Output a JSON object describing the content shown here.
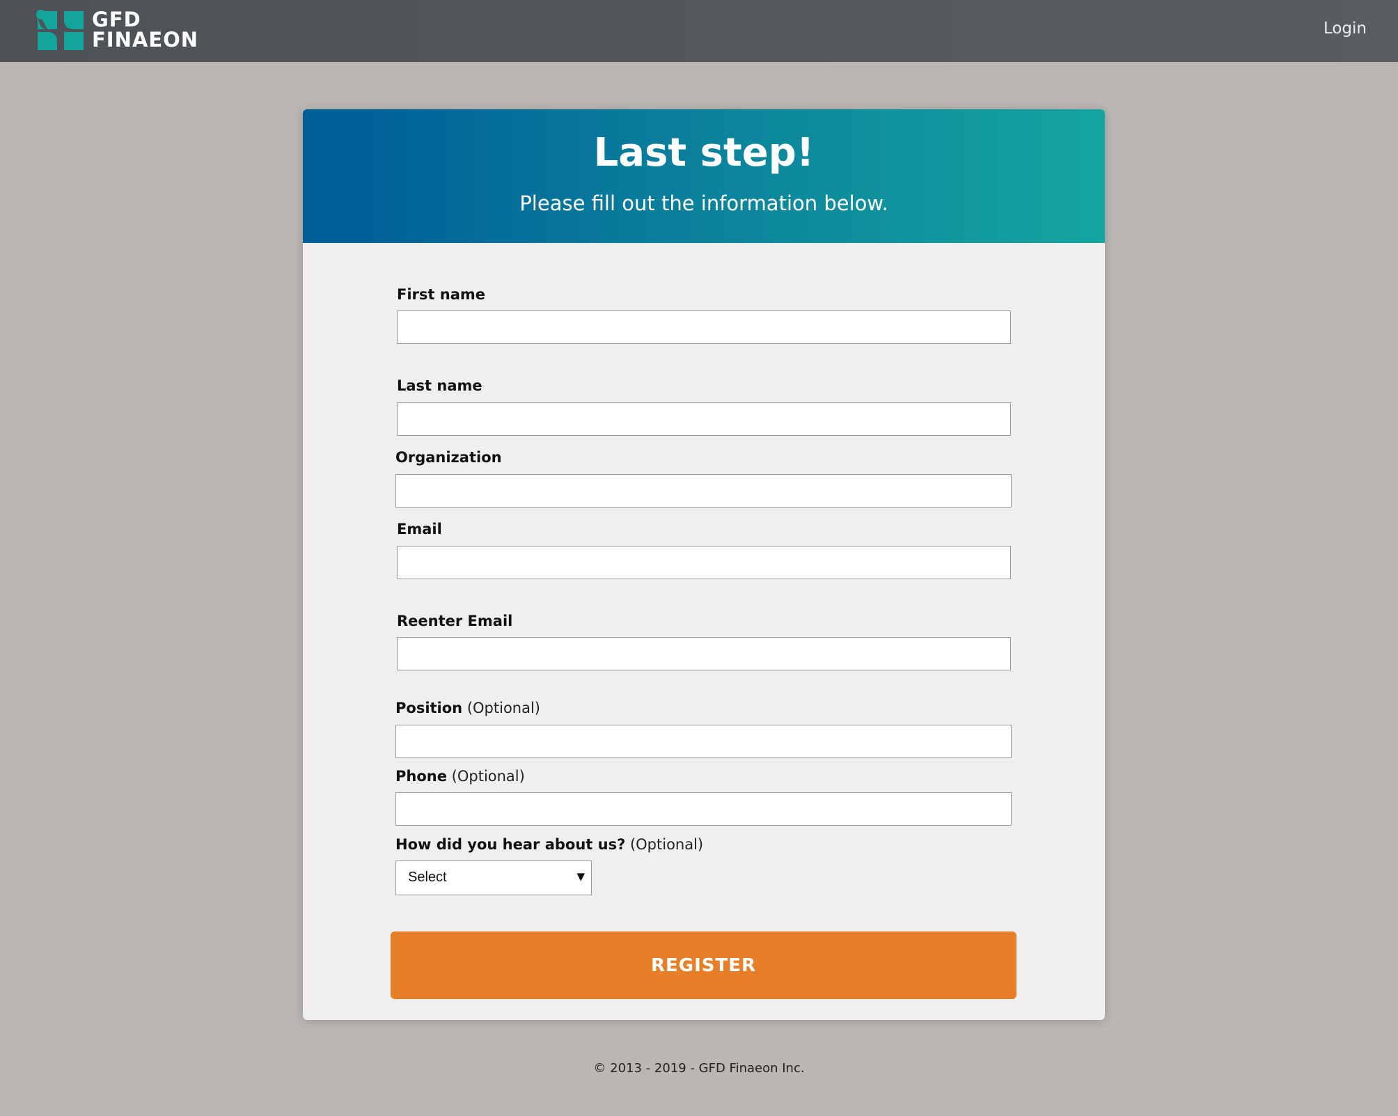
{
  "header": {
    "logo": {
      "line1": "GFD",
      "line2": "FINAEON",
      "mark_color": "#13a59b"
    },
    "login_label": "Login"
  },
  "card": {
    "title": "Last step!",
    "subtitle": "Please fill out the information below."
  },
  "form": {
    "first_name": {
      "label": "First name",
      "value": ""
    },
    "last_name": {
      "label": "Last name",
      "value": ""
    },
    "organization": {
      "label": "Organization",
      "value": ""
    },
    "email": {
      "label": "Email",
      "value": ""
    },
    "reenter_email": {
      "label": "Reenter Email",
      "value": ""
    },
    "position": {
      "label": "Position",
      "optional": "(Optional)",
      "value": ""
    },
    "phone": {
      "label": "Phone",
      "optional": "(Optional)",
      "value": ""
    },
    "hear_about": {
      "label": "How did you hear about us?",
      "optional": "(Optional)",
      "selected": "Select"
    },
    "register_label": "REGISTER"
  },
  "footer": {
    "copyright": "© 2013 - 2019 - GFD Finaeon Inc."
  },
  "colors": {
    "topbar": "#51575b",
    "page_background": "#b9b6b3",
    "card_background": "#f0efee",
    "header_gradient_start": "#006198",
    "header_gradient_end": "#14a59f",
    "register_button": "#e67f27"
  }
}
